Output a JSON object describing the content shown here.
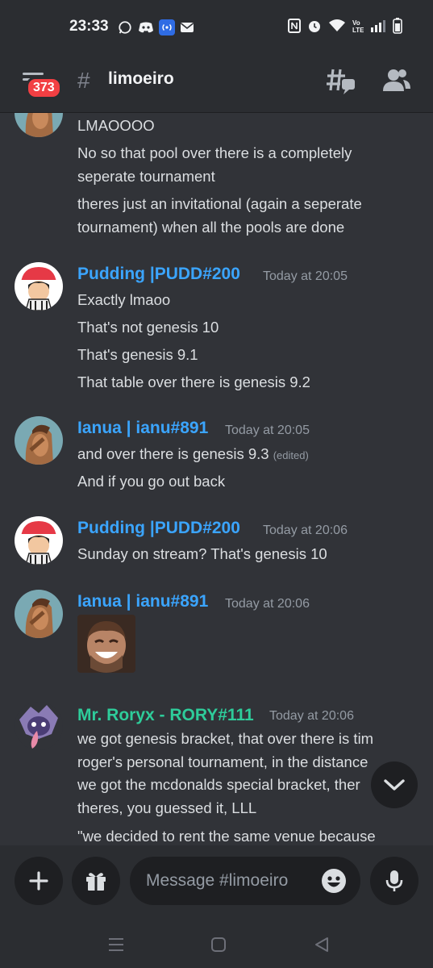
{
  "status_bar": {
    "time": "23:33",
    "left_icons": [
      "whatsapp-icon",
      "discord-icon",
      "hotspot-icon",
      "mail-icon"
    ],
    "right_icons": [
      "nfc-icon",
      "alarm-icon",
      "wifi-icon",
      "volte-icon",
      "signal-icon",
      "battery-icon"
    ]
  },
  "header": {
    "unread_badge": "373",
    "hash": "#",
    "channel_name": "limoeiro"
  },
  "messages": [
    {
      "type": "continuation",
      "lines": [
        "LMAOOOO",
        "No so that pool over there is a completely",
        "seperate tournament",
        "theres just an invitational (again a seperate",
        "tournament) when all the pools are done"
      ]
    },
    {
      "author": "Pudding |PUDD#200",
      "timestamp": "Today at 20:05",
      "color": "#3ba5ff",
      "lines": [
        "Exactly lmaoo",
        "That's not genesis 10",
        "That's genesis 9.1",
        "That table over there is genesis 9.2"
      ]
    },
    {
      "author": "Ianua | ianu#891",
      "timestamp": "Today at 20:05",
      "color": "#3ba5ff",
      "lines": [
        "and over there is genesis 9.3",
        "And if you go out back"
      ],
      "edited": "(edited)"
    },
    {
      "author": "Pudding |PUDD#200",
      "timestamp": "Today at 20:06",
      "color": "#3ba5ff",
      "lines": [
        "Sunday on stream? That's genesis 10"
      ]
    },
    {
      "author": "Ianua | ianu#891",
      "timestamp": "Today at 20:06",
      "color": "#3ba5ff",
      "lines": []
    },
    {
      "author": "Mr. Roryx - RORY#111",
      "timestamp": "Today at 20:06",
      "color": "#2ecc9a",
      "lines": [
        "we got genesis bracket, that over there is tim",
        "roger's personal tournament, in the distance",
        "we got the mcdonalds special bracket, ther",
        "theres, you guessed it, LLL",
        "\"we decided to rent the same venue because"
      ]
    }
  ],
  "composer": {
    "placeholder": "Message #limoeiro"
  }
}
